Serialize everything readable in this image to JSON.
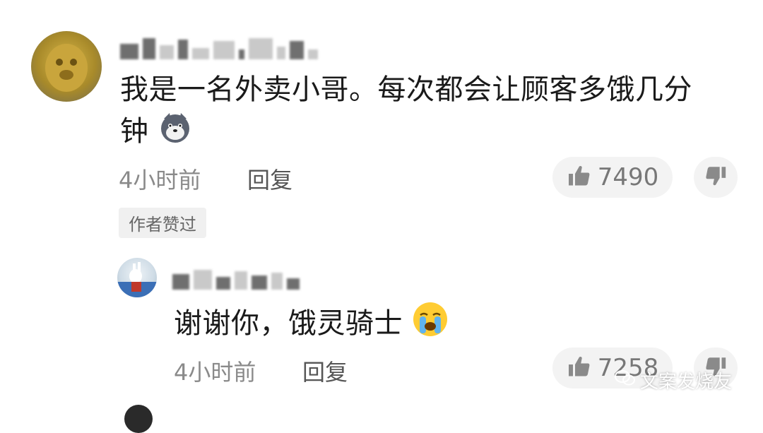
{
  "comments": [
    {
      "text_line1": "我是一名外卖小哥。每次都会让顾客多饿几分",
      "text_line2": "钟",
      "emoji": "dog-face-emoji",
      "time": "4小时前",
      "reply_label": "回复",
      "likes": "7490",
      "badge": "作者赞过"
    },
    {
      "text": "谢谢你，饿灵骑士",
      "emoji": "crying-face-emoji",
      "time": "4小时前",
      "reply_label": "回复",
      "likes": "7258"
    }
  ],
  "watermark": "文案发烧友",
  "colors": {
    "meta": "#8a8a8a",
    "pill_bg": "#f3f3f3",
    "text": "#1a1a1a"
  }
}
